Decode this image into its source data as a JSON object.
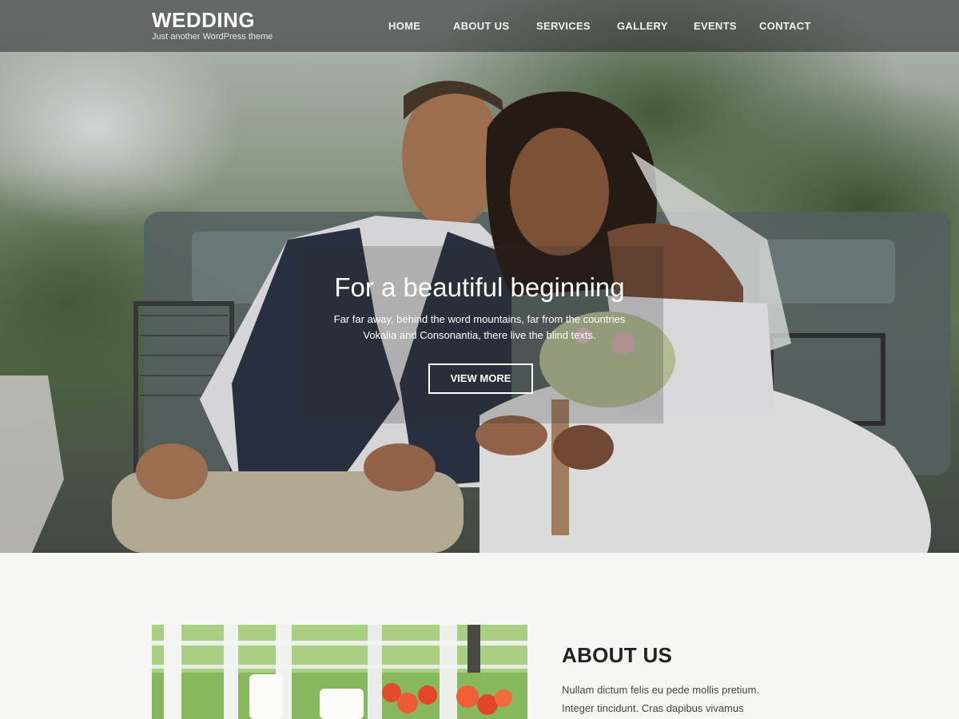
{
  "site": {
    "title": "WEDDING",
    "tagline": "Just another WordPress theme"
  },
  "nav": {
    "items": [
      {
        "label": "HOME"
      },
      {
        "label": "ABOUT US"
      },
      {
        "label": "SERVICES"
      },
      {
        "label": "GALLERY"
      },
      {
        "label": "EVENTS"
      },
      {
        "label": "CONTACT"
      }
    ]
  },
  "hero": {
    "title": "For a beautiful beginning",
    "description_line1": "Far far away, behind the word mountains, far from the countries",
    "description_line2": "Vokalia and Consonantia, there live the blind texts.",
    "button_label": "VIEW MORE"
  },
  "about": {
    "title": "ABOUT US",
    "text_line1": "Nullam dictum felis eu pede mollis pretium.",
    "text_line2": "Integer tincidunt. Cras dapibus vivamus"
  },
  "colors": {
    "header_bg": "#282828",
    "accent_text": "#ffffff",
    "section_bg": "#f6f6f4",
    "heading": "#222222"
  }
}
